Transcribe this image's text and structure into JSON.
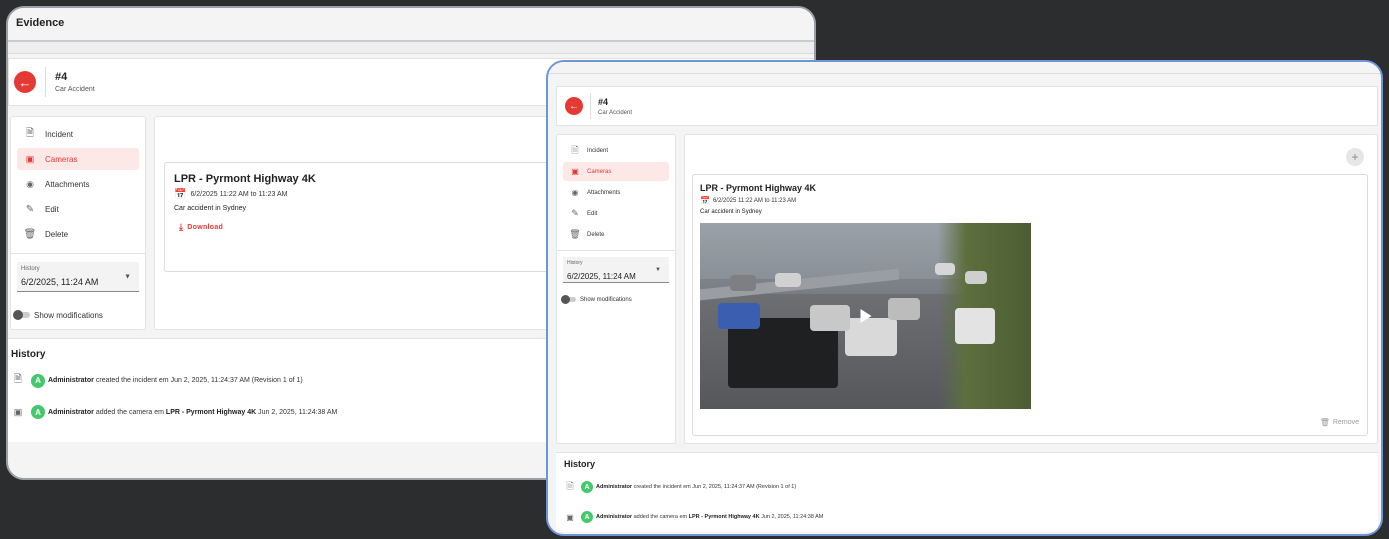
{
  "back": {
    "window_title": "Evidence",
    "case_number": "#4",
    "case_type": "Car Accident",
    "nav": [
      {
        "label": "Incident",
        "icon": "document-icon"
      },
      {
        "label": "Cameras",
        "icon": "camera-icon"
      },
      {
        "label": "Attachments",
        "icon": "attachment-icon"
      },
      {
        "label": "Edit",
        "icon": "pencil-icon"
      },
      {
        "label": "Delete",
        "icon": "trash-icon"
      }
    ],
    "history_label": "History",
    "history_value": "6/2/2025, 11:24 AM",
    "show_modifications": "Show modifications",
    "camera": {
      "title": "LPR - Pyrmont Highway 4K",
      "date_range": "6/2/2025 11:22 AM to 11:23 AM",
      "description": "Car accident in Sydney",
      "download": "Download"
    },
    "history": {
      "title": "History",
      "rows": [
        {
          "avatar": "A",
          "user": "Administrator",
          "text": "created the incident em Jun 2, 2025, 11:24:37 AM (Revision 1 of 1)",
          "bold_suffix": "",
          "tail": ""
        },
        {
          "avatar": "A",
          "user": "Administrator",
          "text": "added the camera em",
          "bold_suffix": "LPR - Pyrmont Highway 4K",
          "tail": "Jun 2, 2025, 11:24:38 AM"
        }
      ]
    }
  },
  "front": {
    "case_number": "#4",
    "case_type": "Car Accident",
    "nav": [
      {
        "label": "Incident",
        "icon": "document-icon"
      },
      {
        "label": "Cameras",
        "icon": "camera-icon"
      },
      {
        "label": "Attachments",
        "icon": "attachment-icon"
      },
      {
        "label": "Edit",
        "icon": "pencil-icon"
      },
      {
        "label": "Delete",
        "icon": "trash-icon"
      }
    ],
    "history_label": "History",
    "history_value": "6/2/2025, 11:24 AM",
    "show_modifications": "Show modifications",
    "camera": {
      "title": "LPR - Pyrmont Highway 4K",
      "date_range": "6/2/2025 11:22 AM to 11:23 AM",
      "description": "Car accident in Sydney",
      "remove": "Remove"
    },
    "history": {
      "title": "History",
      "rows": [
        {
          "avatar": "A",
          "user": "Administrator",
          "text": "created the incident em Jun 2, 2025, 11:24:37 AM (Revision 1 of 1)",
          "bold_suffix": "",
          "tail": ""
        },
        {
          "avatar": "A",
          "user": "Administrator",
          "text": "added the camera em",
          "bold_suffix": "LPR - Pyrmont Highway 4K",
          "tail": "Jun 2, 2025, 11:24:38 AM"
        }
      ]
    }
  }
}
